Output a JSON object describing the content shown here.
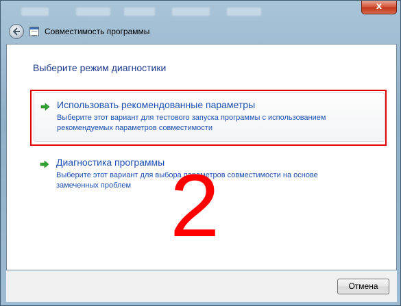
{
  "window": {
    "title": "Совместимость программы",
    "close_label": "x"
  },
  "main": {
    "heading": "Выберите режим диагностики",
    "options": [
      {
        "title": "Использовать рекомендованные параметры",
        "description": "Выберите этот вариант для тестового запуска программы с использованием рекомендуемых параметров совместимости"
      },
      {
        "title": "Диагностика программы",
        "description": "Выберите этот вариант для выбора параметров совместимости на основе замеченных проблем"
      }
    ],
    "annotation_number": "2"
  },
  "footer": {
    "cancel_label": "Отмена"
  },
  "colors": {
    "link_blue": "#1b4fb0",
    "heading_blue": "#1e3a8a",
    "highlight_red": "#e00000",
    "arrow_green": "#2fa52f"
  },
  "icons": {
    "back": "back-arrow-icon",
    "app": "program-compatibility-icon",
    "option_arrow": "green-arrow-icon"
  }
}
